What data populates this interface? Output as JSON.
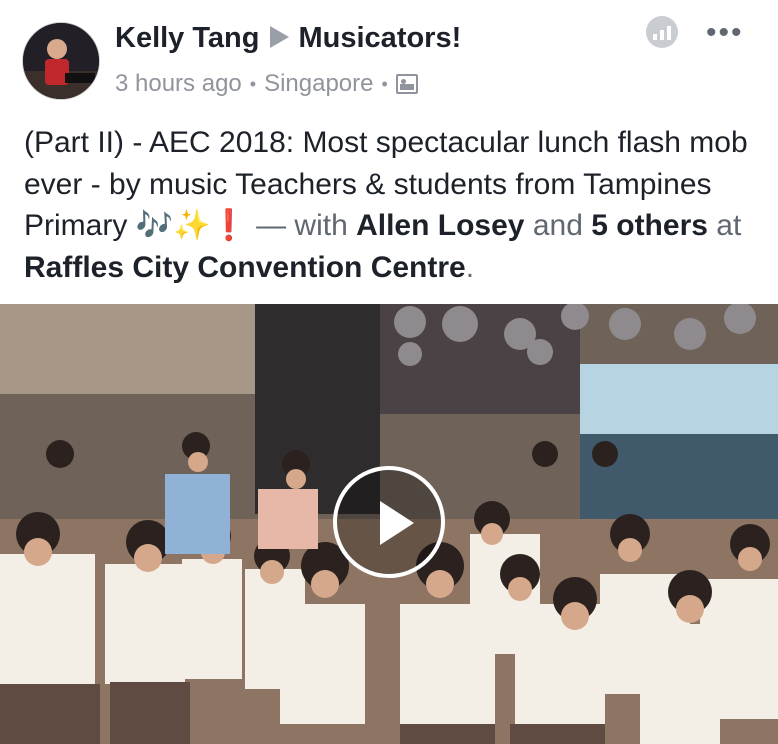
{
  "post": {
    "author": "Kelly Tang",
    "group": "Musicators!",
    "time": "3 hours ago",
    "location": "Singapore",
    "separator": "•",
    "audience_icon": "photo-icon",
    "text_intro": "(Part II) - AEC 2018: Most spectacular lunch flash mob ever - by music Teachers & students from Tampines Primary ",
    "emoji": "🎶✨❗",
    "with_prefix": " — with ",
    "tagged_person": "Allen Losey",
    "and_word": " and ",
    "others": "5 others",
    "at_word": " at ",
    "venue": "Raffles City Convention Centre",
    "period": "."
  },
  "icons": {
    "stats": "bar-chart-icon",
    "more": "more-dots-icon",
    "play": "play-icon"
  },
  "colors": {
    "name": "#1d2129",
    "meta": "#90949c",
    "accent_gray": "#c9ccd1"
  }
}
